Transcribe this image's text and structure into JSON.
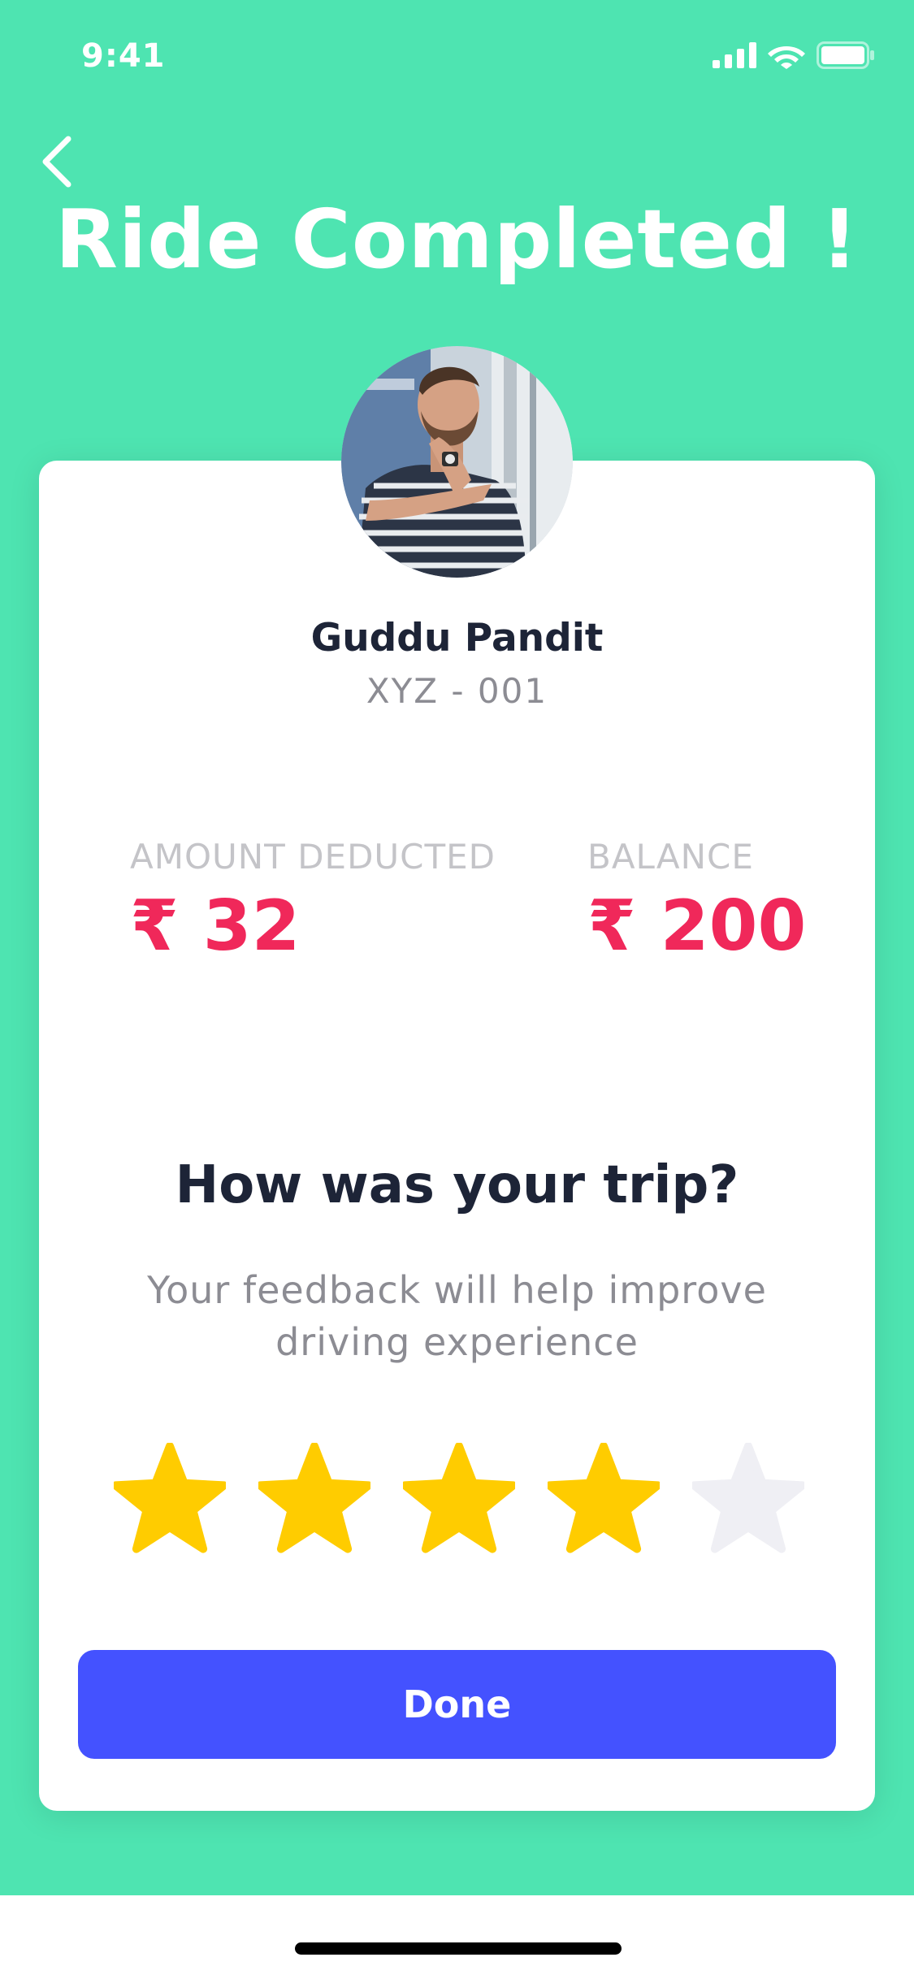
{
  "status_bar": {
    "time": "9:41",
    "icons": [
      "cellular-signal-icon",
      "wifi-icon",
      "battery-icon"
    ]
  },
  "header": {
    "back_icon": "chevron-left-icon",
    "title": "Ride Completed !"
  },
  "driver": {
    "name": "Guddu Pandit",
    "vehicle_id": "XYZ - 001"
  },
  "fare": {
    "amount_deducted_label": "AMOUNT DEDUCTED",
    "amount_deducted_value": "₹ 32",
    "balance_label": "BALANCE",
    "balance_value": "₹ 200"
  },
  "feedback": {
    "question": "How was your trip?",
    "subtitle": "Your feedback will help improve driving experience",
    "rating": 4,
    "max_rating": 5
  },
  "actions": {
    "done_label": "Done"
  },
  "colors": {
    "background": "#4ee4b1",
    "accent_red": "#f0285a",
    "button_blue": "#4452ff",
    "star_filled": "#ffcc00",
    "star_empty": "#efeff4",
    "text_dark": "#1d2437",
    "text_gray": "#8c8c93"
  }
}
